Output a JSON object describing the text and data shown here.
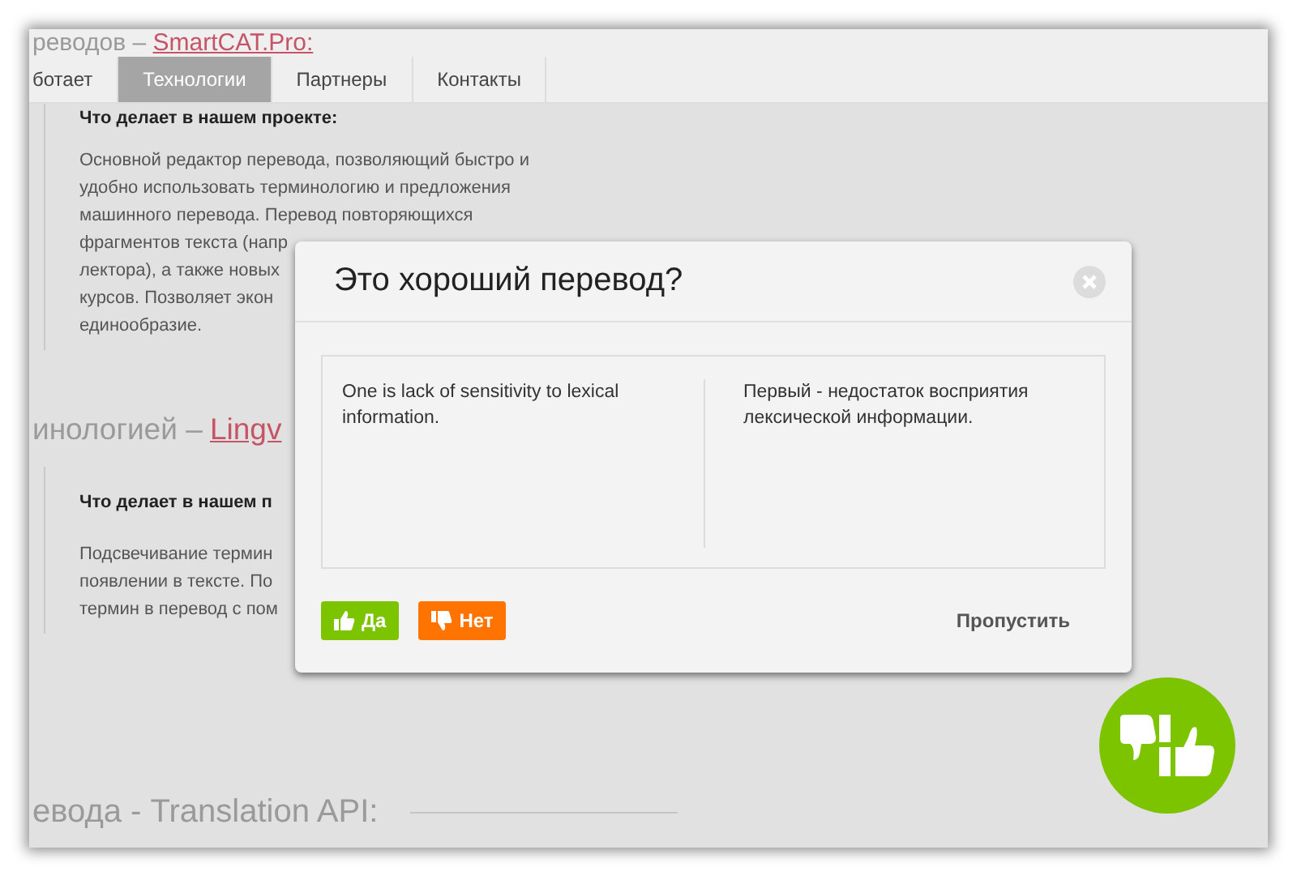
{
  "page_heading": {
    "text": "реводов – ",
    "link": "SmartCAT.Pro:"
  },
  "nav": {
    "tabs": [
      {
        "label": "ботает",
        "selected": false
      },
      {
        "label": "Технологии",
        "selected": true
      },
      {
        "label": "Партнеры",
        "selected": false
      },
      {
        "label": "Контакты",
        "selected": false
      }
    ]
  },
  "sections": [
    {
      "block": {
        "title": "Что делает в нашем проекте:",
        "lines": [
          "Основной редактор перевода, позволяющий быстро и",
          "удобно использовать терминологию и предложения",
          "машинного перевода. Перевод повторяющихся",
          "фрагментов текста (напр",
          "лектора), а также новых",
          "курсов. Позволяет экон",
          "единообразие."
        ]
      }
    },
    {
      "heading": {
        "text": "инологией – ",
        "link": "Lingv"
      },
      "block": {
        "title": "Что делает в нашем п",
        "lines": [
          "Подсвечивание термин",
          "появлении в тексте. По",
          "термин в перевод с пом"
        ]
      }
    },
    {
      "heading": {
        "text": "евода - Translation API:"
      }
    }
  ],
  "modal": {
    "title": "Это хороший перевод?",
    "source": "One is lack of sensitivity to lexical information.",
    "translation": "Первый - недостаток восприятия лексической информации.",
    "buttons": [
      {
        "kind": "yes",
        "label": "Да"
      },
      {
        "kind": "no",
        "label": "Нет"
      }
    ],
    "skip": "Пропустить"
  }
}
